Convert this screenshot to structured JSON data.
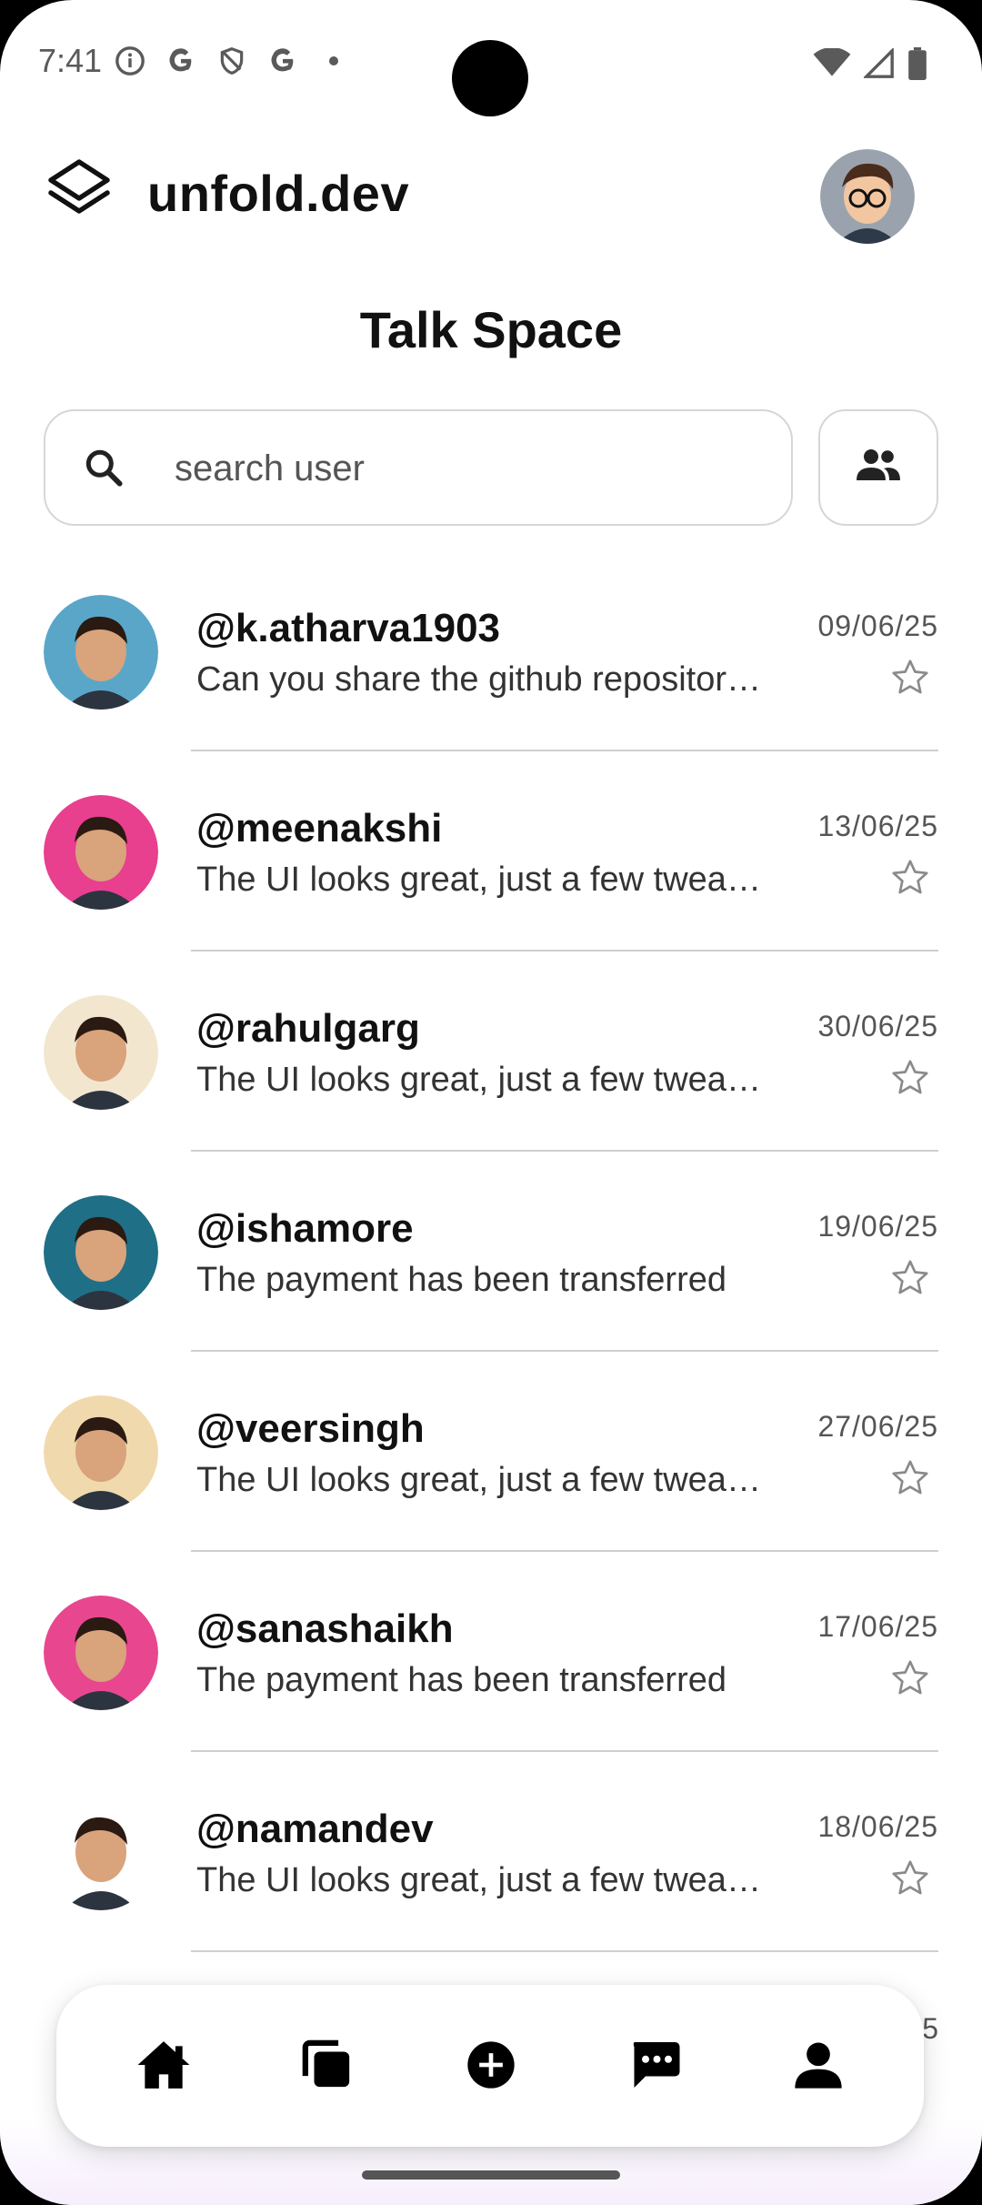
{
  "status_bar": {
    "time": "7:41"
  },
  "header": {
    "app_name": "unfold.dev"
  },
  "page_title": "Talk Space",
  "search": {
    "placeholder": "search user",
    "value": ""
  },
  "chats": [
    {
      "username": "@k.atharva1903",
      "message": "Can you share the github repository link?",
      "date": "09/06/25",
      "avatar_color": "#5aa6c9"
    },
    {
      "username": "@meenakshi",
      "message": "The UI looks great, just a few tweaks needed",
      "date": "13/06/25",
      "avatar_color": "#e83f8f"
    },
    {
      "username": "@rahulgarg",
      "message": "The UI looks great, just a few tweaks needed",
      "date": "30/06/25",
      "avatar_color": "#f3e6cf"
    },
    {
      "username": "@ishamore",
      "message": "The payment has been transferred",
      "date": "19/06/25",
      "avatar_color": "#1f6f86"
    },
    {
      "username": "@veersingh",
      "message": "The UI looks great, just a few tweaks needed",
      "date": "27/06/25",
      "avatar_color": "#f1d9ae"
    },
    {
      "username": "@sanashaikh",
      "message": "The payment has been transferred",
      "date": "17/06/25",
      "avatar_color": "#e8478f"
    },
    {
      "username": "@namandev",
      "message": "The UI looks great, just a few tweaks needed",
      "date": "18/06/25",
      "avatar_color": "#ffffff"
    }
  ],
  "partial_row": {
    "date_fragment": "5"
  },
  "bottom_nav": [
    "home-icon",
    "pages-icon",
    "add-icon",
    "chat-icon",
    "profile-icon"
  ]
}
